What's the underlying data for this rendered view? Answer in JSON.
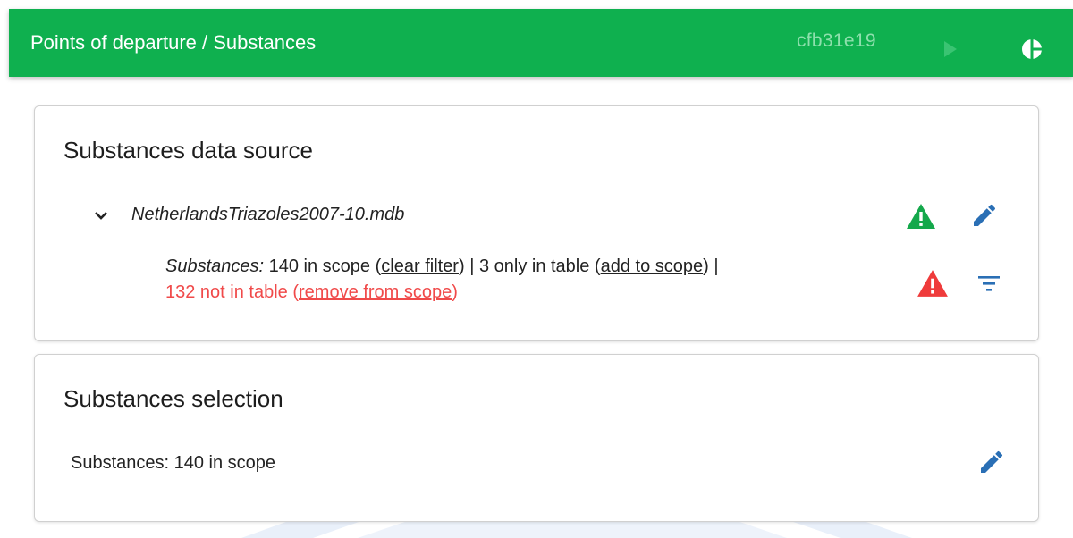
{
  "header": {
    "title": "Points of departure / Substances",
    "hash": "cfb31e19",
    "play_icon": "play-icon",
    "pie_icon": "pie-chart-icon",
    "bar_color": "#0fb04f"
  },
  "data_source_card": {
    "title": "Substances data source",
    "file": {
      "name": "NetherlandsTriazoles2007-10.mdb",
      "expand_icon": "chevron-down-icon",
      "status_icon": "warning-green-icon",
      "edit_icon": "edit-icon"
    },
    "summary": {
      "label": "Substances:",
      "in_scope": " 140 in scope (",
      "clear_filter": "clear filter",
      "only_in_table": ") | 3 only in table (",
      "add_to_scope": "add to scope",
      "sep": ") |",
      "not_in_table": "132 not in table ",
      "remove_open": "(",
      "remove_from_scope": "remove from scope",
      "remove_close": ")",
      "status_icon": "warning-red-icon",
      "filter_icon": "filter-icon"
    }
  },
  "selection_card": {
    "title": "Substances selection",
    "text": "Substances: 140 in scope",
    "edit_icon": "edit-icon"
  },
  "colors": {
    "green_warning": "#14a84b",
    "red_warning": "#ef3b3b",
    "edit_blue": "#2a6fb5",
    "red_text": "#f04a4a"
  }
}
